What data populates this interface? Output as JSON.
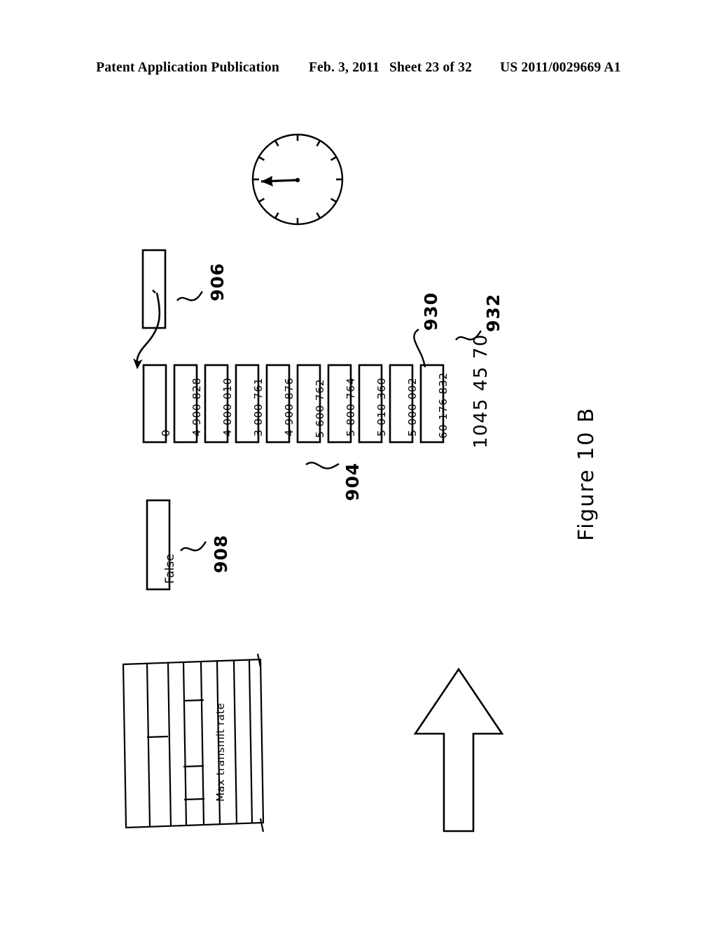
{
  "header": {
    "publication": "Patent Application Publication",
    "date": "Feb. 3, 2011",
    "sheet": "Sheet 23 of 32",
    "patent_number": "US 2011/0029669 A1"
  },
  "figure": {
    "caption": "Figure 10 B"
  },
  "diagram": {
    "array": {
      "ref_numeral": "904",
      "cells": [
        {
          "value": "0"
        },
        {
          "value": "4 900 828"
        },
        {
          "value": "4 000 010"
        },
        {
          "value": "3 000 761"
        },
        {
          "value": "4 900 876"
        },
        {
          "value": "5 600 762"
        },
        {
          "value": "5 800 764"
        },
        {
          "value": "5 010 360"
        },
        {
          "value": "5 000 002"
        },
        {
          "value": "60 176 832"
        }
      ]
    },
    "source_box": {
      "ref_numeral": "906",
      "value": ""
    },
    "false_box": {
      "ref_numeral": "908",
      "value": "False"
    },
    "last_cell_callout": {
      "ref_numeral": "930"
    },
    "total_callout": {
      "ref_numeral": "932",
      "value": "1045 45 70"
    },
    "grid": {
      "label": "Max transmit rate"
    },
    "clock": {
      "tick_count": 12,
      "hand_direction": "left"
    },
    "arrow": {
      "direction": "up"
    }
  },
  "colors": {
    "ink": "#000000",
    "page": "#ffffff"
  }
}
